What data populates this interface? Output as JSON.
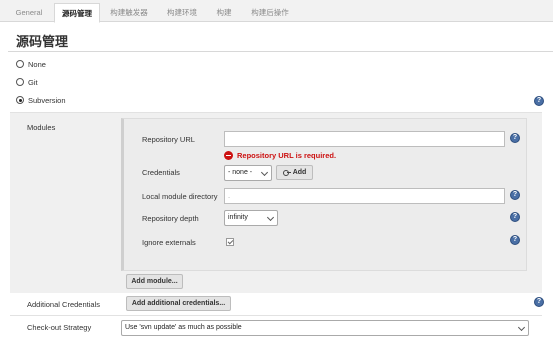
{
  "tabs": [
    {
      "label": "General"
    },
    {
      "label": "源码管理"
    },
    {
      "label": "构建触发器"
    },
    {
      "label": "构建环境"
    },
    {
      "label": "构建"
    },
    {
      "label": "构建后操作"
    }
  ],
  "page_title": "源码管理",
  "scm_options": [
    {
      "label": "None",
      "selected": false
    },
    {
      "label": "Git",
      "selected": false
    },
    {
      "label": "Subversion",
      "selected": true
    }
  ],
  "modules": {
    "section_label": "Modules",
    "repository_url": {
      "label": "Repository URL",
      "value": "",
      "error": "Repository URL is required."
    },
    "credentials": {
      "label": "Credentials",
      "selected": "- none -",
      "add_label": "Add"
    },
    "local_module_directory": {
      "label": "Local module directory",
      "value": "."
    },
    "repository_depth": {
      "label": "Repository depth",
      "selected": "infinity"
    },
    "ignore_externals": {
      "label": "Ignore externals",
      "checked": true
    },
    "add_module_label": "Add module..."
  },
  "additional_credentials": {
    "label": "Additional Credentials",
    "button_label": "Add additional credentials..."
  },
  "checkout_strategy": {
    "label": "Check-out Strategy",
    "selected": "Use 'svn update' as much as possible"
  },
  "help_glyph": "?",
  "colors": {
    "error": "#cc1111",
    "help": "#4a6fa5",
    "section_bg": "#f0f0f0"
  }
}
